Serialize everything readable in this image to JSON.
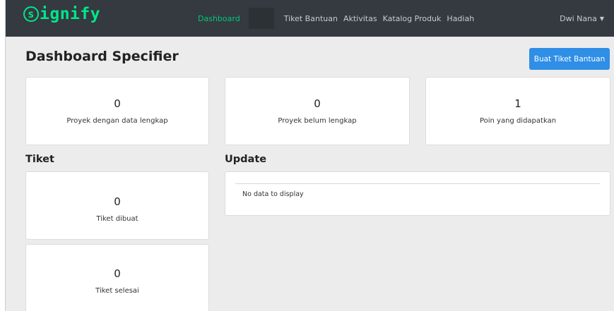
{
  "brand": {
    "letter": "s",
    "rest": "ignify"
  },
  "nav": {
    "dashboard": "Dashboard",
    "items": [
      "Tiket Bantuan",
      "Aktivitas",
      "Katalog Produk",
      "Hadiah"
    ]
  },
  "user": {
    "name": "Dwi Nana"
  },
  "page": {
    "title": "Dashboard Specifier",
    "create_ticket_button": "Buat Tiket Bantuan"
  },
  "stats": [
    {
      "value": "0",
      "label": "Proyek dengan data lengkap"
    },
    {
      "value": "0",
      "label": "Proyek belum lengkap"
    },
    {
      "value": "1",
      "label": "Poin yang didapatkan"
    }
  ],
  "tiket": {
    "title": "Tiket",
    "cards": [
      {
        "value": "0",
        "label": "Tiket dibuat"
      },
      {
        "value": "0",
        "label": "Tiket selesai"
      }
    ]
  },
  "update": {
    "title": "Update",
    "empty_message": "No data to display"
  },
  "colors": {
    "navbar": "#343a40",
    "brand": "#00e68a",
    "primary": "#2f8ee6",
    "background": "#ececec"
  }
}
